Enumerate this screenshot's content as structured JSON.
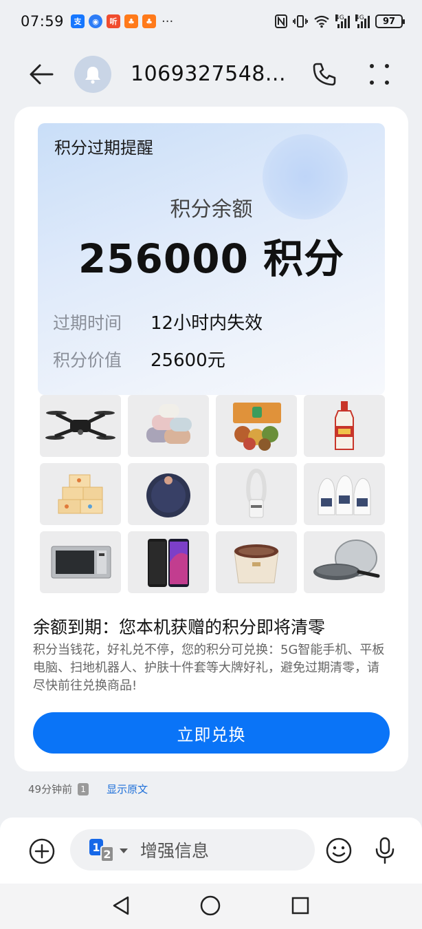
{
  "status_bar": {
    "time": "07:59",
    "notifications": [
      {
        "icon": "alipay-icon",
        "glyph": "支"
      },
      {
        "icon": "browser-icon",
        "glyph": "◉"
      },
      {
        "icon": "listen-app-icon",
        "glyph": "听"
      },
      {
        "icon": "game-app-icon",
        "glyph": "♣"
      },
      {
        "icon": "game-app-icon-2",
        "glyph": "♣"
      }
    ],
    "more_notifications": "···",
    "network_label_1": "4G",
    "network_label_2": "4G",
    "battery": "97"
  },
  "header": {
    "contact_name": "1069327548...",
    "back_icon": "arrow-left-icon",
    "avatar_icon": "bell-icon",
    "call_icon": "phone-icon",
    "more_icon": "more-vertical-icon"
  },
  "message": {
    "banner": {
      "title": "积分过期提醒",
      "balance_label": "积分余额",
      "balance_value": "256000 积分",
      "rows": [
        {
          "key": "过期时间",
          "value": "12小时内失效"
        },
        {
          "key": "积分价值",
          "value": "25600元"
        }
      ]
    },
    "products": [
      {
        "name": "drone"
      },
      {
        "name": "towels"
      },
      {
        "name": "snack-gift-box"
      },
      {
        "name": "liquor-bottle"
      },
      {
        "name": "tissue-boxes"
      },
      {
        "name": "robot-vacuum"
      },
      {
        "name": "bladeless-fan"
      },
      {
        "name": "detergent-bottles"
      },
      {
        "name": "microwave-oven"
      },
      {
        "name": "smartphone"
      },
      {
        "name": "foot-spa-basin"
      },
      {
        "name": "wok-pan"
      }
    ],
    "headline": "余额到期：您本机获赠的积分即将清零",
    "body": "积分当钱花，好礼兑不停，您的积分可兑换：5G智能手机、平板电脑、扫地机器人、护肤十件套等大牌好礼，避免过期清零，请尽快前往兑换商品!",
    "cta": "立即兑换"
  },
  "meta": {
    "time_ago": "49分钟前",
    "sim": "1",
    "show_original": "显示原文"
  },
  "input_bar": {
    "sim_primary": "1",
    "sim_secondary": "2",
    "placeholder": "增强信息"
  },
  "colors": {
    "accent": "#0a74f7",
    "link": "#1e6fd9",
    "background": "#eef0f3"
  }
}
